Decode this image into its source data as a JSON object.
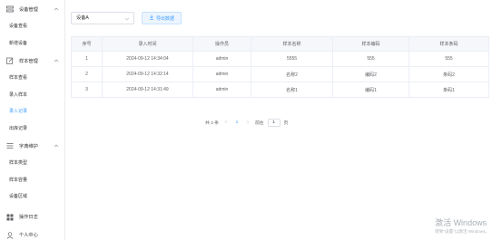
{
  "sidebar": {
    "group1": {
      "label": "设备管理"
    },
    "group1_items": [
      {
        "label": "设备查看"
      },
      {
        "label": "新增设备"
      }
    ],
    "group2": {
      "label": "样本管理"
    },
    "group2_items": [
      {
        "label": "样本查看"
      },
      {
        "label": "录入样本"
      },
      {
        "label": "录入记录"
      },
      {
        "label": "出库记录"
      }
    ],
    "group3": {
      "label": "字典维护"
    },
    "group3_items": [
      {
        "label": "样本类型"
      },
      {
        "label": "样本容量"
      },
      {
        "label": "设备区域"
      }
    ],
    "group4": {
      "label": "操作日志"
    },
    "group5": {
      "label": "个人中心"
    },
    "active_item": "录入记录"
  },
  "toolbar": {
    "device_select_value": "设备A",
    "export_label": "导出数据"
  },
  "table": {
    "headers": [
      "序号",
      "录入时间",
      "操作员",
      "样本名称",
      "样本编码",
      "样本条码"
    ],
    "rows": [
      [
        "1",
        "2024-09-12 14:34:04",
        "admin",
        "5555",
        "555",
        "555"
      ],
      [
        "2",
        "2024-09-12 14:32:14",
        "admin",
        "名称2",
        "编码2",
        "条码2"
      ],
      [
        "3",
        "2024-09-12 14:31:49",
        "admin",
        "名称1",
        "编码1",
        "条码1"
      ]
    ]
  },
  "pagination": {
    "total_text": "共 3 条",
    "prev": "<",
    "current_page": "1",
    "next": ">",
    "goto_label": "前往",
    "goto_value": "1",
    "page_suffix": "页"
  },
  "watermark": {
    "line1": "激活 Windows",
    "line2": "转到\"设置\"以激活 Windows。"
  },
  "colors": {
    "accent": "#409eff",
    "header_bg": "#f5f7fa",
    "border": "#ebeef5"
  }
}
